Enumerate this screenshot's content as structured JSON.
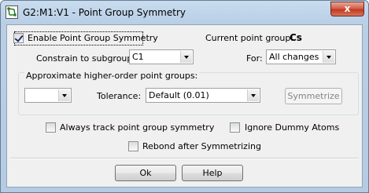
{
  "window": {
    "title": "G2:M1:V1 - Point Group Symmetry",
    "close_glyph": "x",
    "accent_close": "#c94d34"
  },
  "enable": {
    "label": "Enable Point Group Symmetry",
    "checked": true
  },
  "current_point_group": {
    "label": "Current point group:",
    "value": "Cs"
  },
  "constrain": {
    "label": "Constrain to subgroup:",
    "value": "C1"
  },
  "for": {
    "label": "For:",
    "value": "All changes"
  },
  "approx": {
    "group_label": "Approximate higher-order point groups:",
    "group_value": "",
    "tolerance_label": "Tolerance:",
    "tolerance_value": "Default (0.01)",
    "symmetrize_label": "Symmetrize"
  },
  "options": {
    "always_track": {
      "label": "Always track point group symmetry",
      "checked": false
    },
    "ignore_dummy": {
      "label": "Ignore Dummy Atoms",
      "checked": false
    },
    "rebond": {
      "label": "Rebond after Symmetrizing",
      "checked": false
    }
  },
  "buttons": {
    "ok": "Ok",
    "help": "Help"
  },
  "icons": {
    "app": "molecule-app-icon",
    "dropdown": "chevron-down-icon",
    "close": "close-icon"
  }
}
